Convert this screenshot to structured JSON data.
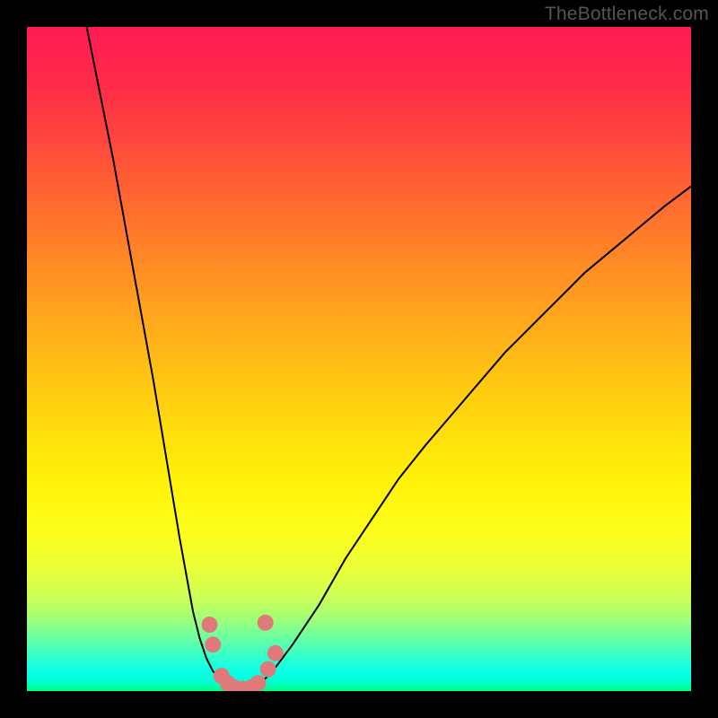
{
  "attribution": "TheBottleneck.com",
  "chart_data": {
    "type": "line",
    "title": "",
    "xlabel": "",
    "ylabel": "",
    "xlim": [
      0,
      100
    ],
    "ylim": [
      0,
      100
    ],
    "grid": false,
    "legend": false,
    "background": "heatmap-gradient",
    "gradient_stops": [
      {
        "pos": 0,
        "color": "#ff1b52"
      },
      {
        "pos": 50,
        "color": "#ffd50e"
      },
      {
        "pos": 85,
        "color": "#c9ff58"
      },
      {
        "pos": 100,
        "color": "#00ff73"
      }
    ],
    "series": [
      {
        "name": "left-curve",
        "stroke": "#000000",
        "x": [
          9,
          11,
          13,
          15,
          17,
          19,
          21,
          23,
          25,
          26,
          27,
          28,
          29,
          30
        ],
        "y": [
          100,
          90,
          80,
          69,
          58,
          47,
          35,
          23,
          12,
          8,
          5,
          3,
          2,
          1
        ]
      },
      {
        "name": "right-curve",
        "stroke": "#000000",
        "x": [
          35,
          37,
          40,
          44,
          48,
          52,
          56,
          60,
          66,
          72,
          78,
          84,
          90,
          96,
          100
        ],
        "y": [
          1,
          3,
          7,
          13,
          20,
          26,
          32,
          37,
          44,
          51,
          57,
          63,
          68,
          73,
          76
        ]
      },
      {
        "name": "valley-floor",
        "stroke": "#000000",
        "x": [
          30,
          31,
          32,
          33,
          34,
          35
        ],
        "y": [
          1,
          0.3,
          0,
          0,
          0.3,
          1
        ]
      }
    ],
    "markers": [
      {
        "name": "marker-cluster",
        "color": "#e07a7a",
        "r": 9,
        "points": [
          {
            "x": 27.5,
            "y": 10
          },
          {
            "x": 28.0,
            "y": 7
          },
          {
            "x": 29.3,
            "y": 2.3
          },
          {
            "x": 30.2,
            "y": 1.2
          },
          {
            "x": 31.3,
            "y": 0.5
          },
          {
            "x": 32.5,
            "y": 0.3
          },
          {
            "x": 33.7,
            "y": 0.5
          },
          {
            "x": 34.8,
            "y": 1.2
          },
          {
            "x": 36.3,
            "y": 3.3
          },
          {
            "x": 37.4,
            "y": 5.7
          },
          {
            "x": 35.9,
            "y": 10.3
          }
        ]
      }
    ]
  }
}
